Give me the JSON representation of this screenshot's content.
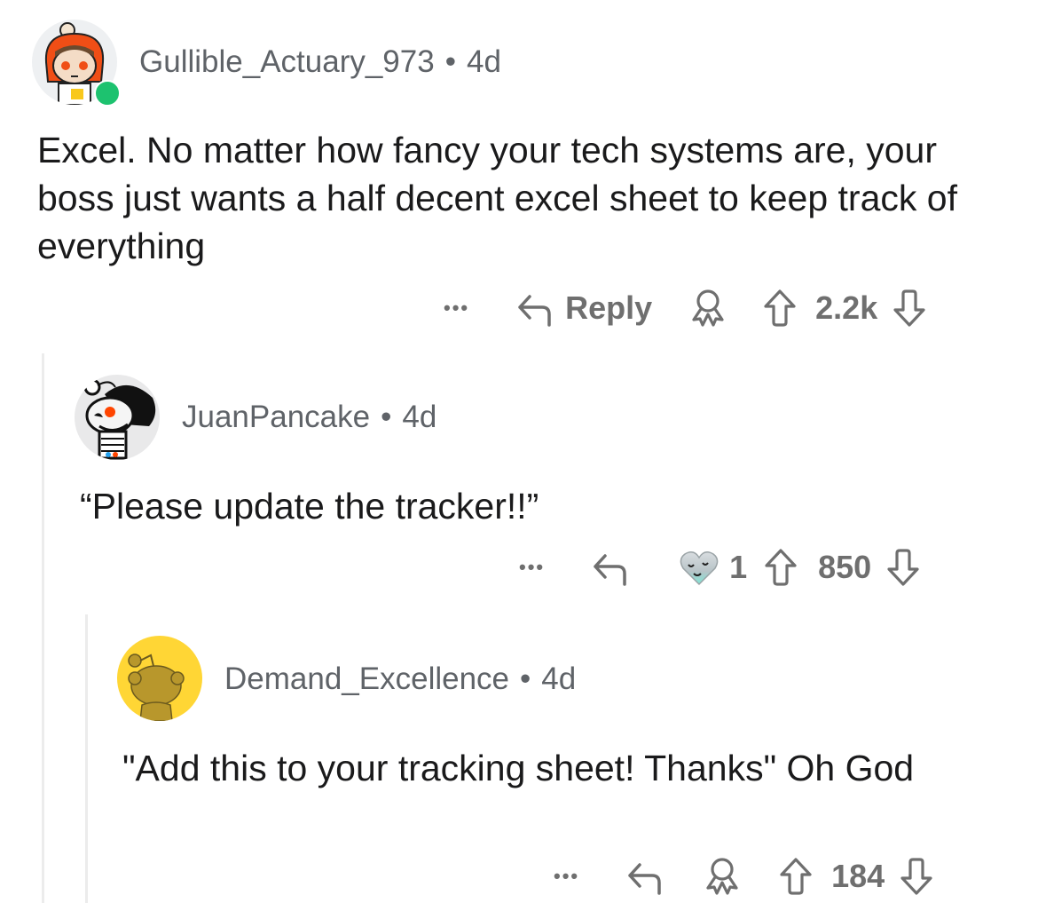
{
  "comments": [
    {
      "username": "Gullible_Actuary_973",
      "age": "4d",
      "online": true,
      "body": "Excel. No matter how fancy your tech systems are, your boss just wants a half decent excel sheet to keep track of everything",
      "actions": {
        "more": "•••",
        "reply_label": "Reply",
        "score": "2.2k"
      },
      "avatar_icon": "snoo-red-hood-avatar"
    },
    {
      "username": "JuanPancake",
      "age": "4d",
      "body": "“Please update the tracker!!”",
      "actions": {
        "more": "•••",
        "award_count": "1",
        "score": "850"
      },
      "avatar_icon": "snoo-skeleton-avatar"
    },
    {
      "username": "Demand_Excellence",
      "age": "4d",
      "body": "\"Add this to your tracking sheet! Thanks\" Oh God",
      "actions": {
        "more": "•••",
        "score": "184"
      },
      "avatar_icon": "snoo-default-yellow-avatar"
    }
  ],
  "colors": {
    "online": "#1dc26f",
    "meta": "#5f6368",
    "icon": "#6f6f6f",
    "avatar_yellow": "#ffd635"
  }
}
